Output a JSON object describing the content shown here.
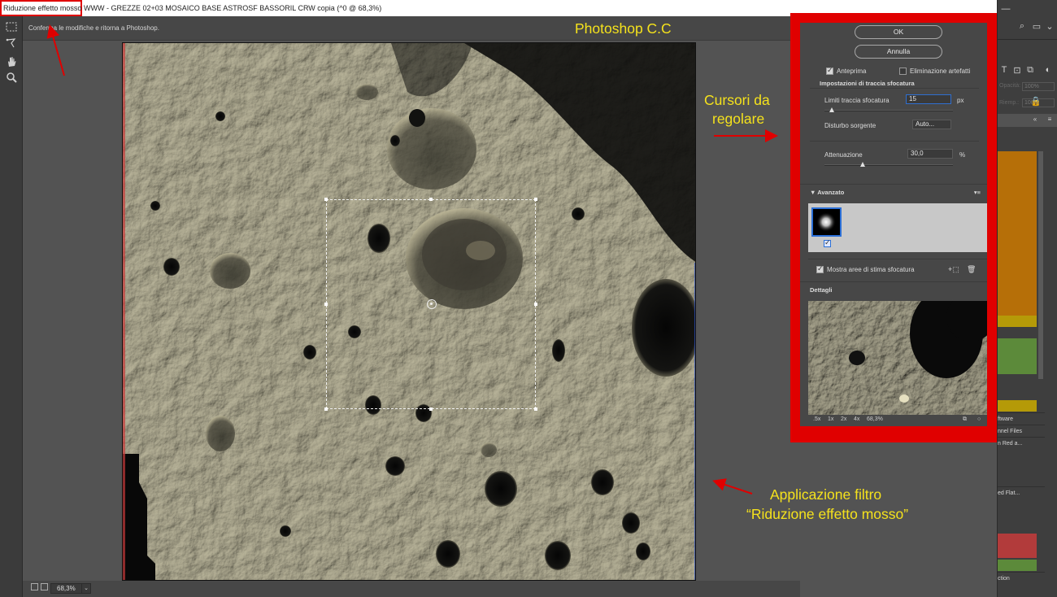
{
  "titlebar": {
    "dialog_title": "Riduzione effetto mosso",
    "document_title": "WWW - GREZZE 02+03 MOSAICO BASE ASTROSF BASSORIL CRW copia (^0 @ 68,3%)"
  },
  "optionbar": {
    "hint": "Conferma le modifiche e ritorna a Photoshop."
  },
  "statusbar": {
    "zoom": "68,3%"
  },
  "dialog": {
    "ok_label": "OK",
    "cancel_label": "Annulla",
    "preview_label": "Anteprima",
    "preview_checked": true,
    "artifact_label": "Eliminazione artefatti",
    "artifact_checked": false,
    "trace_section": "Impostazioni di traccia sfocatura",
    "limit_label": "Limiti traccia sfocatura",
    "limit_value": "15",
    "limit_unit": "px",
    "noise_label": "Disturbo sorgente",
    "noise_value": "Auto...",
    "smoothing_label": "Attenuazione",
    "smoothing_value": "30,0",
    "smoothing_unit": "%",
    "advanced_label": "Avanzato",
    "show_areas_label": "Mostra aree di stima sfocatura",
    "show_areas_checked": true,
    "details_label": "Dettagli",
    "zoom_levels": [
      ".5x",
      "1x",
      "2x",
      "4x",
      "68,3%"
    ]
  },
  "rightpanel": {
    "opacity_label": "Opacità:",
    "opacity_value": "100%",
    "fill_label": "Riemp.:",
    "fill_value": "100%",
    "items": [
      "ftware",
      "nnel Files",
      "n Red a...",
      "ed Flat...",
      "ction"
    ]
  },
  "annotations": {
    "app_name": "Photoshop C.C",
    "sliders_line1": "Cursori da",
    "sliders_line2": "regolare",
    "filter_line1": "Applicazione filtro",
    "filter_line2": "“Riduzione effetto mosso”"
  },
  "colors": {
    "annotation_yellow": "#f5e21c",
    "highlight_red": "#e00000",
    "layer_orange": "#b66f08",
    "layer_yellow": "#b59a08",
    "layer_green": "#5c8a3a",
    "layer_red": "#b23b3b"
  },
  "icons": {
    "tool_marquee": "marquee-tool-icon",
    "tool_lasso": "lasso-tool-icon",
    "tool_hand": "hand-tool-icon",
    "tool_zoom": "zoom-tool-icon"
  }
}
